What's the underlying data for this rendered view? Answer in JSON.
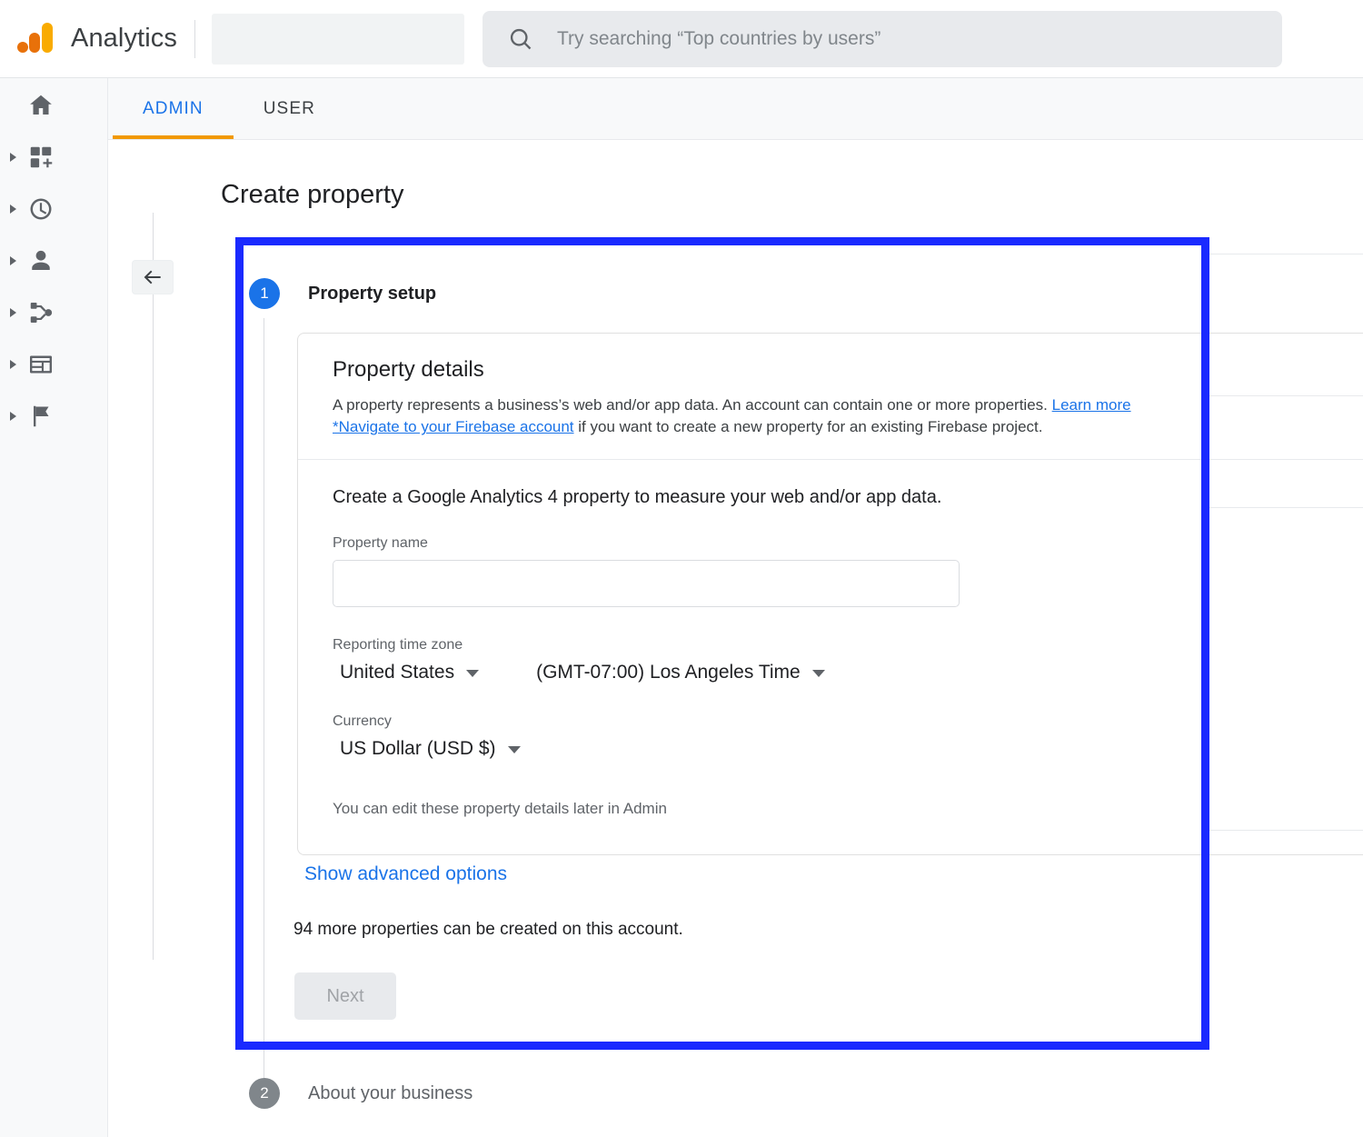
{
  "header": {
    "brand_name": "Analytics",
    "logo_icon": "google-analytics-logo",
    "search_icon": "search-icon",
    "search_placeholder": "Try searching “Top countries by users”",
    "search_value": ""
  },
  "sidebar": {
    "items": [
      {
        "icon": "home-icon",
        "expandable": false
      },
      {
        "icon": "add-dashboard-icon",
        "expandable": true
      },
      {
        "icon": "realtime-clock-icon",
        "expandable": true
      },
      {
        "icon": "person-icon",
        "expandable": true
      },
      {
        "icon": "share-branch-icon",
        "expandable": true
      },
      {
        "icon": "library-layout-icon",
        "expandable": true
      },
      {
        "icon": "flag-icon",
        "expandable": true
      }
    ]
  },
  "tabs": [
    {
      "label": "ADMIN",
      "active": true
    },
    {
      "label": "USER",
      "active": false
    }
  ],
  "main": {
    "page_title": "Create property",
    "collapse_icon": "arrow-left-icon"
  },
  "stepper": {
    "step1": {
      "number": "1",
      "label": "Property setup",
      "state": "active"
    },
    "step2": {
      "number": "2",
      "label": "About your business",
      "state": "pending"
    }
  },
  "card": {
    "details_heading": "Property details",
    "details_desc_part1": "A property represents a business’s web and/or app data. An account can contain one or more properties. ",
    "learn_more_link": "Learn more",
    "firebase_link": "*Navigate to your Firebase account",
    "details_desc_part2": " if you want to create a new property for an existing Firebase project.",
    "body_lead": "Create a Google Analytics 4 property to measure your web and/or app data.",
    "property_name_label": "Property name",
    "property_name_value": "",
    "property_name_placeholder": "",
    "timezone_label": "Reporting time zone",
    "timezone_country": "United States",
    "timezone_zone": "(GMT-07:00) Los Angeles Time",
    "currency_label": "Currency",
    "currency_value": "US Dollar (USD $)",
    "edit_note": "You can edit these property details later in Admin"
  },
  "actions": {
    "advanced_options_label": "Show advanced options",
    "quota_note": "94 more properties can be created on this account.",
    "next_label": "Next",
    "next_disabled": true
  },
  "colors": {
    "google_blue": "#1a73e8",
    "annotation_blue": "#1a2aff",
    "tab_underline_orange": "#f29900",
    "logo_orange": "#e8710a",
    "logo_amber": "#f9ab00",
    "text_primary": "#202124",
    "text_secondary": "#5f6368"
  }
}
